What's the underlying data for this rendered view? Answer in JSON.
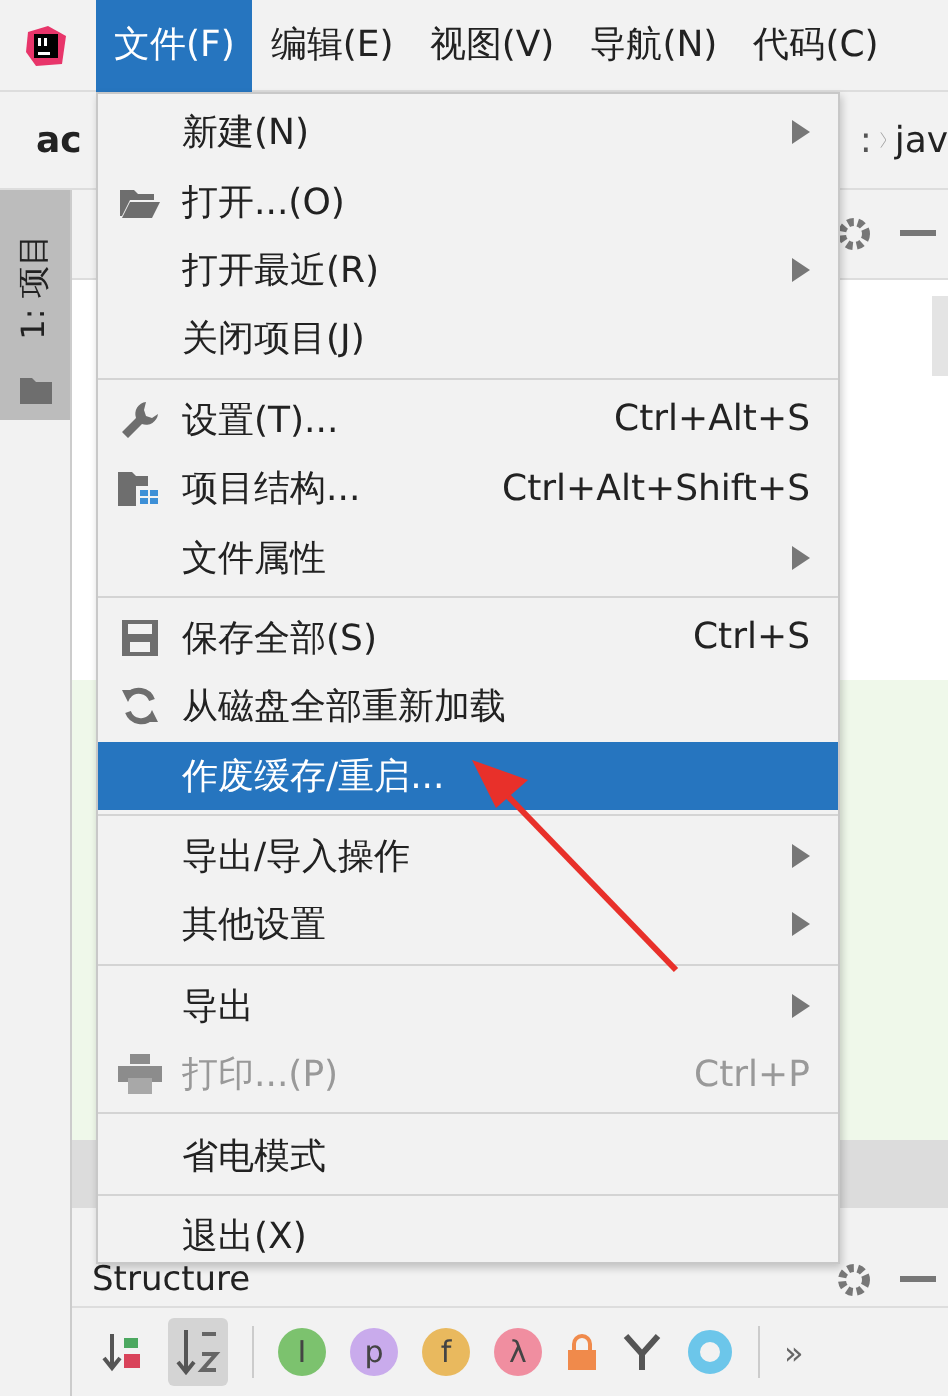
{
  "menubar": [
    {
      "label": "文件(F)",
      "selected": true
    },
    {
      "label": "编辑(E)",
      "selected": false
    },
    {
      "label": "视图(V)",
      "selected": false
    },
    {
      "label": "导航(N)",
      "selected": false
    },
    {
      "label": "代码(C)",
      "selected": false
    }
  ],
  "breadcrumb": {
    "project": "ac",
    "separator": ":",
    "path_end": "jav"
  },
  "tool_strip": {
    "tab": "1: 项目"
  },
  "menu": {
    "groups": [
      [
        {
          "label": "新建(N)",
          "submenu": true,
          "selected": false,
          "disabled": false
        },
        {
          "label": "打开...(O)",
          "submenu": false,
          "selected": false,
          "disabled": false,
          "icon": true
        },
        {
          "label": "打开最近(R)",
          "submenu": true,
          "selected": false,
          "disabled": false
        },
        {
          "label": "关闭项目(J)",
          "submenu": false,
          "selected": false,
          "disabled": false
        }
      ],
      [
        {
          "label": "设置(T)...",
          "shortcut": "Ctrl+Alt+S",
          "submenu": false,
          "selected": false,
          "disabled": false,
          "icon": true
        },
        {
          "label": "项目结构...",
          "shortcut": "Ctrl+Alt+Shift+S",
          "submenu": false,
          "selected": false,
          "disabled": false,
          "icon": true
        },
        {
          "label": "文件属性",
          "submenu": true,
          "selected": false,
          "disabled": false
        }
      ],
      [
        {
          "label": "保存全部(S)",
          "shortcut": "Ctrl+S",
          "submenu": false,
          "selected": false,
          "disabled": false,
          "icon": true
        },
        {
          "label": "从磁盘全部重新加载",
          "submenu": false,
          "selected": false,
          "disabled": false,
          "icon": true
        },
        {
          "label": "作废缓存/重启...",
          "submenu": false,
          "selected": true,
          "disabled": false
        }
      ],
      [
        {
          "label": "导出/导入操作",
          "submenu": true,
          "selected": false,
          "disabled": false
        },
        {
          "label": "其他设置",
          "submenu": true,
          "selected": false,
          "disabled": false
        }
      ],
      [
        {
          "label": "导出",
          "submenu": true,
          "selected": false,
          "disabled": false
        },
        {
          "label": "打印...(P)",
          "shortcut": "Ctrl+P",
          "submenu": false,
          "selected": false,
          "disabled": true,
          "icon": true
        }
      ],
      [
        {
          "label": "省电模式",
          "submenu": false,
          "selected": false,
          "disabled": false
        }
      ],
      [
        {
          "label": "退出(X)",
          "submenu": false,
          "selected": false,
          "disabled": false
        }
      ]
    ]
  },
  "structure": {
    "title": "Structure"
  },
  "toolbar": [
    {
      "label": "I",
      "color": "#7cc26e"
    },
    {
      "label": "p",
      "color": "#c9abec"
    },
    {
      "label": "f",
      "color": "#e9b95e"
    },
    {
      "label": "λ",
      "color": "#f08ea0"
    }
  ],
  "overflow": "»"
}
